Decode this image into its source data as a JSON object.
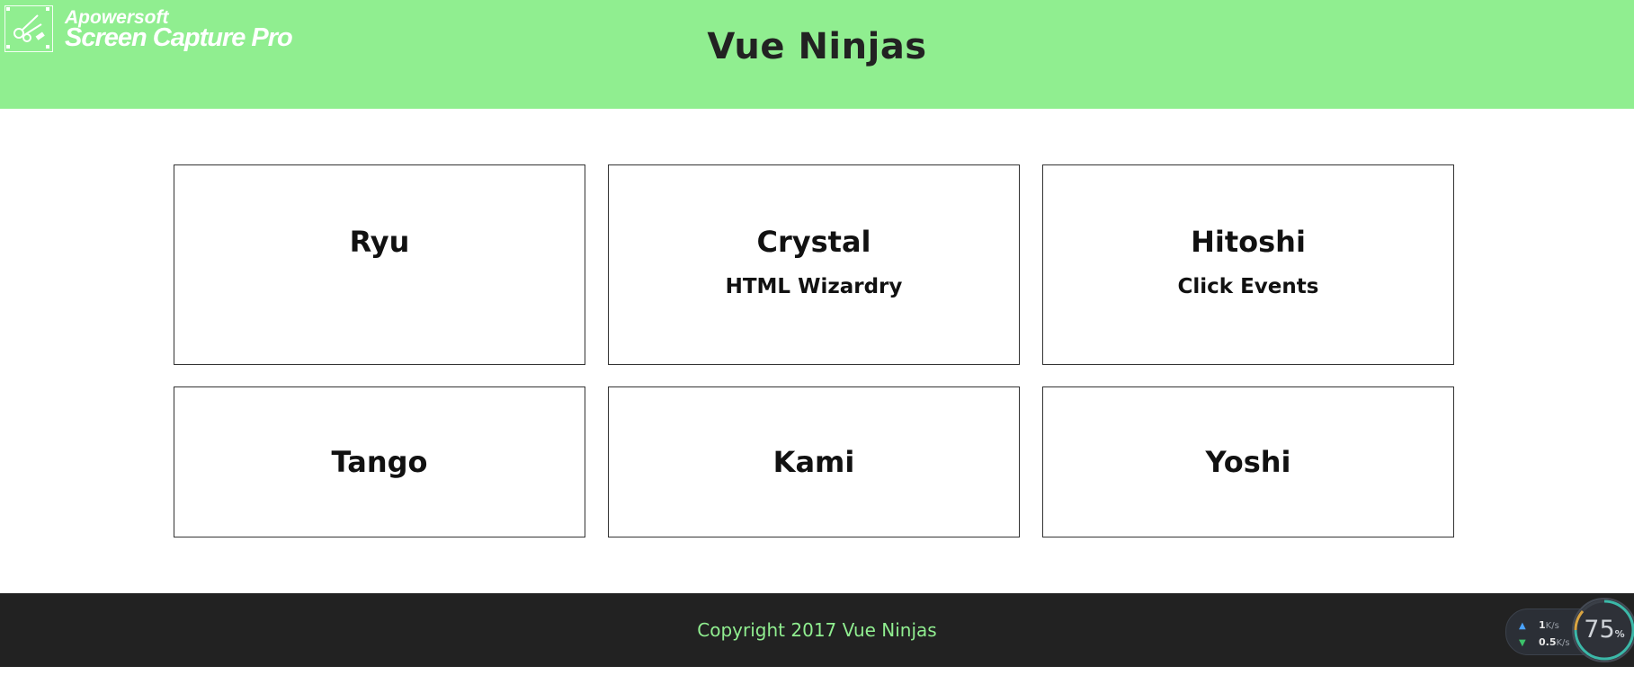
{
  "header": {
    "title": "Vue Ninjas",
    "background": "#90ee90"
  },
  "watermark": {
    "line1": "Apowersoft",
    "line2": "Screen Capture Pro",
    "icon": "scissors-icon"
  },
  "ninjas": [
    {
      "name": "Ryu",
      "skill": ""
    },
    {
      "name": "Crystal",
      "skill": "HTML Wizardry"
    },
    {
      "name": "Hitoshi",
      "skill": "Click Events"
    },
    {
      "name": "Tango",
      "skill": ""
    },
    {
      "name": "Kami",
      "skill": ""
    },
    {
      "name": "Yoshi",
      "skill": ""
    }
  ],
  "footer": {
    "copyright": "Copyright 2017 Vue Ninjas",
    "background": "#222222",
    "text_color": "#90ee90"
  },
  "network_widget": {
    "upload_value": "1",
    "upload_unit": "K/s",
    "download_value": "0.5",
    "download_unit": "K/s",
    "gauge_value": "75",
    "gauge_unit": "%",
    "upload_color": "#4aa3ff",
    "download_color": "#3cc36a"
  }
}
